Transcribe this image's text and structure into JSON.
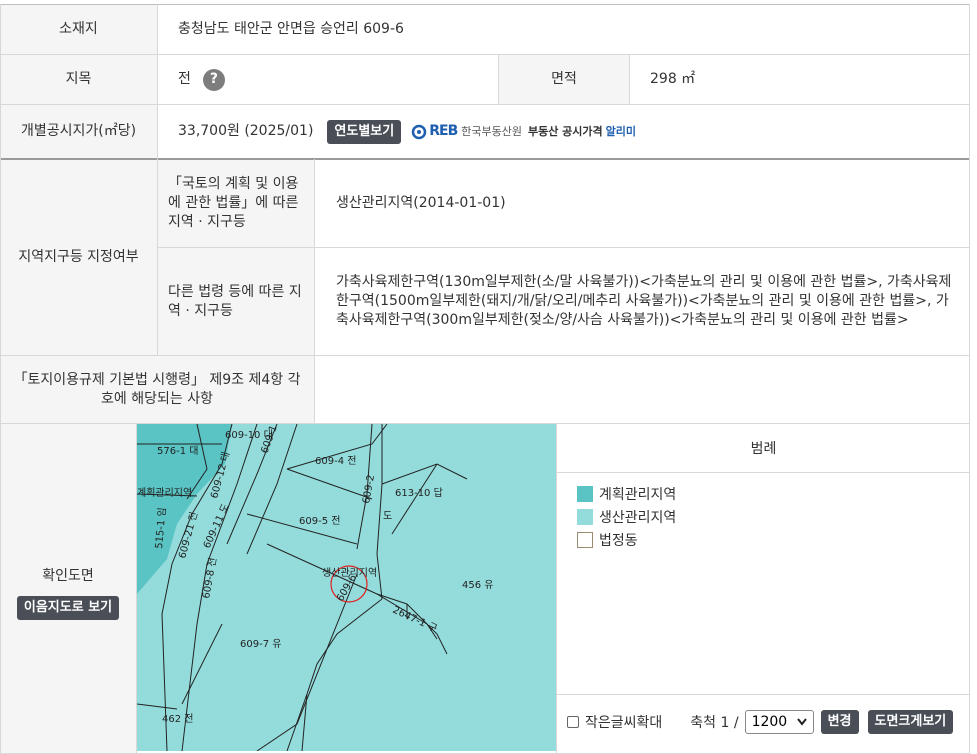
{
  "rows": {
    "location": {
      "label": "소재지",
      "value": "충청남도 태안군 안면읍 승언리 609-6"
    },
    "land_category": {
      "label": "지목",
      "value": "전",
      "help_icon": "?"
    },
    "area": {
      "label": "면적",
      "value": "298 ㎡"
    },
    "price": {
      "label": "개별공시지가(㎡당)",
      "value": "33,700원 (2025/01)",
      "button": "연도별보기",
      "logo_text": "한국부동산원",
      "logo_brand": "REB",
      "logo_service": "부동산 공시가격",
      "logo_service_highlight": "알리미"
    },
    "zone": {
      "label": "지역지구등 지정여부",
      "sub1_label": "「국토의 계획 및 이용에 관한 법률」에 따른 지역 · 지구등",
      "sub1_value": "생산관리지역(2014-01-01)",
      "sub2_label": "다른 법령 등에 따른 지역 · 지구등",
      "sub2_value": "가축사육제한구역(130m일부제한(소/말 사육불가))<가축분뇨의 관리 및 이용에 관한 법률>, 가축사육제한구역(1500m일부제한(돼지/개/닭/오리/메추리 사육불가))<가축분뇨의 관리 및 이용에 관한 법률>, 가축사육제한구역(300m일부제한(젖소/양/사슴 사육불가))<가축분뇨의 관리 및 이용에 관한 법률>"
    },
    "regulation": {
      "label": "「토지이용규제 기본법 시행령」 제9조 제4항 각 호에 해당되는 사항",
      "value": ""
    },
    "map": {
      "label": "확인도면",
      "button": "이음지도로 보기"
    }
  },
  "map_labels": [
    "576-1 대",
    "609-10 대",
    "609-1 전",
    "609-4 전",
    "609-12 대",
    "계획관리지역",
    "609-11 도",
    "609-21 전",
    "515-1 임",
    "609-5 전",
    "613-10 답",
    "609-8 전",
    "생산관리지역",
    "609-6",
    "456 유",
    "609-7 유",
    "462 전",
    "609-2",
    "도",
    "2647-1 구"
  ],
  "legend": {
    "title": "범례",
    "items": [
      {
        "label": "계획관리지역",
        "color": "#5ac4c4"
      },
      {
        "label": "생산관리지역",
        "color": "#94dcdc"
      },
      {
        "label": "법정동",
        "color": "#ffffff"
      }
    ]
  },
  "controls": {
    "small_text_zoom": "작은글씨확대",
    "scale_label": "축척 1 /",
    "scale_value": "1200",
    "scale_options": [
      "1200"
    ],
    "change_button": "변경",
    "enlarge_button": "도면크게보기"
  },
  "colors": {
    "label_bg": "#f5f5f5",
    "border": "#d8d8d8",
    "button": "#4a4f57",
    "plan_zone": "#5ac4c4",
    "production_zone": "#94dcdc"
  }
}
